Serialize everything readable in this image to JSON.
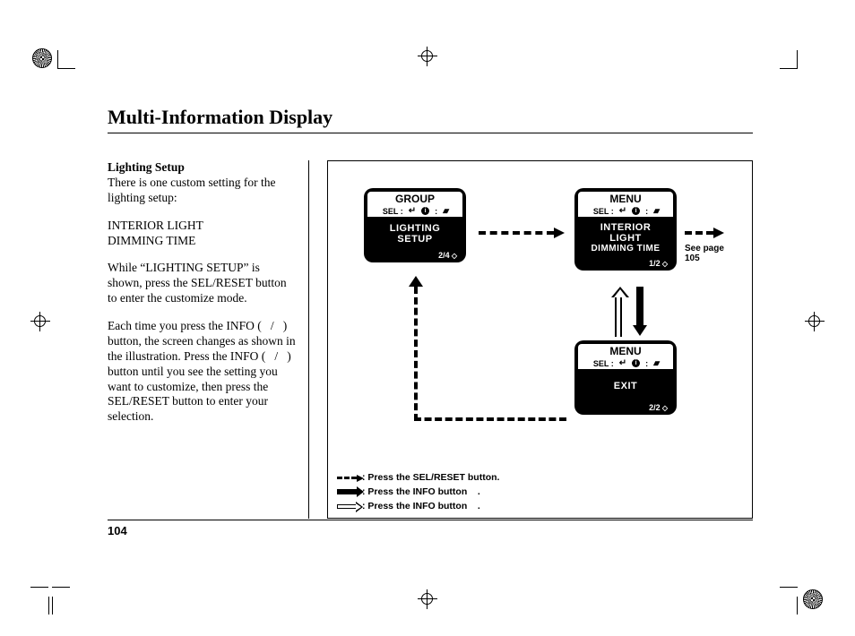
{
  "title": "Multi-Information Display",
  "page_number": "104",
  "text": {
    "subhead": "Lighting Setup",
    "p1": "There is one custom setting for the lighting setup:",
    "setting_line1": "INTERIOR LIGHT",
    "setting_line2": "DIMMING TIME",
    "p2": "While “LIGHTING SETUP” is shown, press the SEL/RESET button to enter the customize mode.",
    "p3": "Each time you press the INFO (   /   ) button, the screen changes as shown in the illustration. Press the INFO (   /   ) button until you see the setting you want to customize, then press the SEL/RESET button to enter your selection."
  },
  "diagram": {
    "screens": {
      "a": {
        "header": "GROUP",
        "sel_label": "SEL :",
        "body_line1": "LIGHTING",
        "body_line2": "SETUP",
        "footer": "2/4"
      },
      "b": {
        "header": "MENU",
        "sel_label": "SEL :",
        "body_line1": "INTERIOR",
        "body_line2": "LIGHT",
        "body_line3": "DIMMING TIME",
        "footer": "1/2"
      },
      "c": {
        "header": "MENU",
        "sel_label": "SEL :",
        "body": "EXIT",
        "footer": "2/2"
      }
    },
    "see_page_label": "See page",
    "see_page_num": "105",
    "legend": {
      "dash": ": Press the SEL/RESET button.",
      "solid": ": Press the INFO button    .",
      "hollow": ": Press the INFO button    ."
    }
  }
}
